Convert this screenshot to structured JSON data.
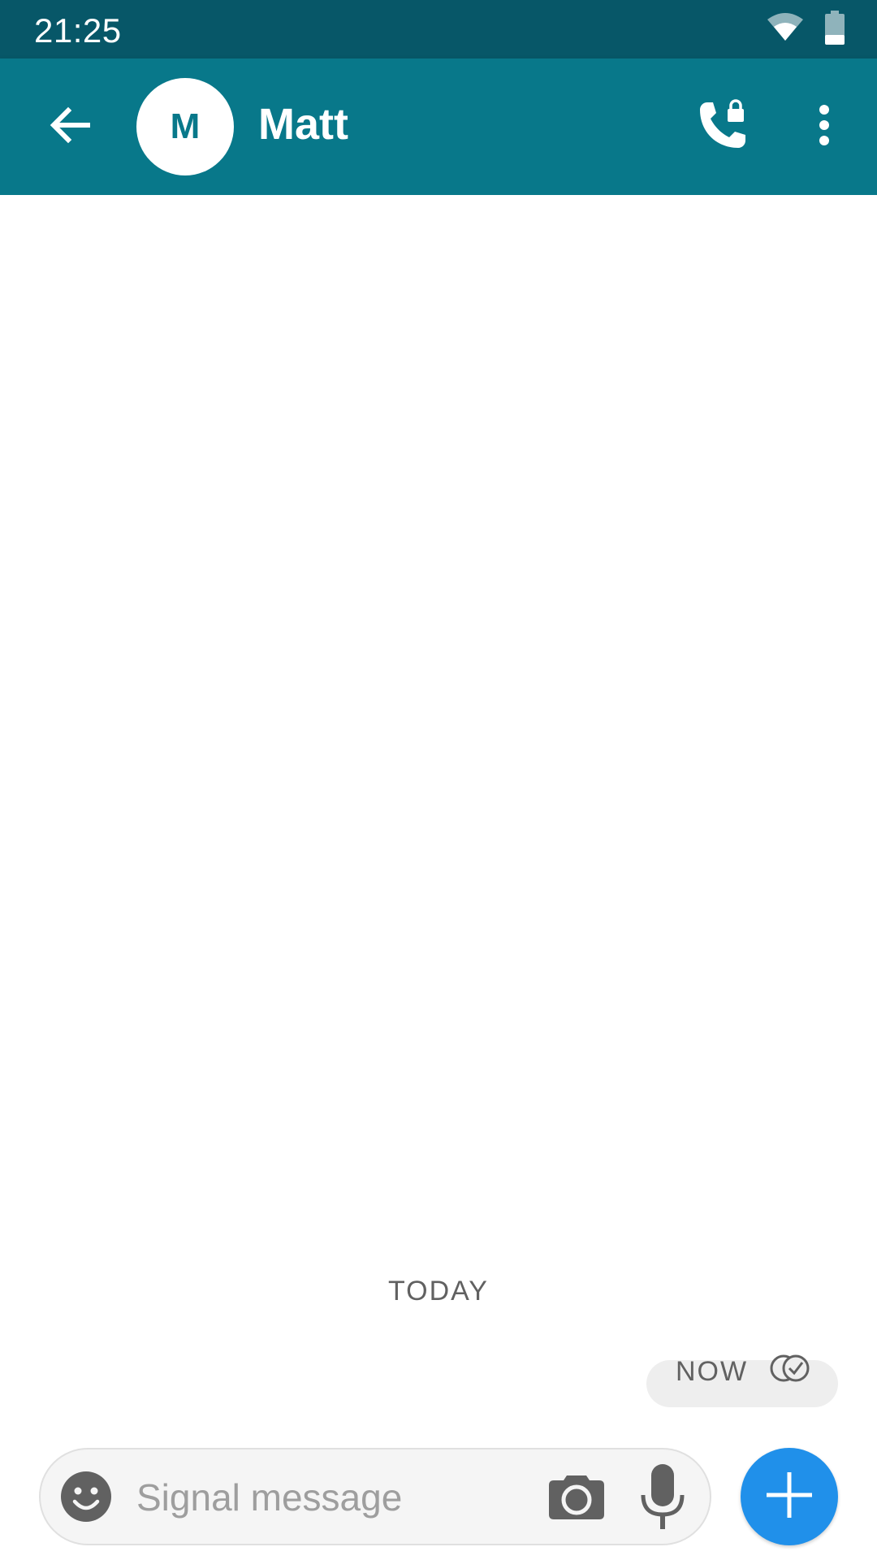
{
  "status_bar": {
    "time": "21:25",
    "icons": [
      "wifi-icon",
      "battery-icon"
    ]
  },
  "app_bar": {
    "contact_initial": "M",
    "contact_name": "Matt",
    "icons": [
      "back-arrow-icon",
      "secure-call-icon",
      "more-vert-icon"
    ],
    "color": "#08788A",
    "status_color": "#075768"
  },
  "conversation": {
    "date_header": "TODAY",
    "messages": [
      {
        "time": "NOW",
        "status_icon": "delivered-check-icon"
      }
    ]
  },
  "composer": {
    "placeholder": "Signal message",
    "icons": [
      "emoji-icon",
      "camera-icon",
      "mic-icon"
    ],
    "fab_icon": "plus-icon",
    "fab_color": "#2090EA"
  }
}
